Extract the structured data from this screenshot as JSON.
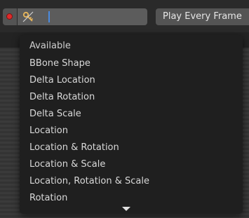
{
  "header": {
    "record_icon": "record-dot-icon",
    "keying_set_icon": "keying-set-key-icon",
    "keying_set_value": "",
    "playback_mode": "Play Every Frame"
  },
  "menu": {
    "title": "Available",
    "items": [
      {
        "label": "BBone Shape"
      },
      {
        "label": "Delta Location"
      },
      {
        "label": "Delta Rotation"
      },
      {
        "label": "Delta Scale"
      },
      {
        "label": "Location"
      },
      {
        "label": "Location & Rotation"
      },
      {
        "label": "Location & Scale"
      },
      {
        "label": "Location, Rotation & Scale"
      },
      {
        "label": "Rotation"
      }
    ],
    "scroll_indicator_icon": "chevron-down-icon"
  },
  "colors": {
    "record": "#e02a2a",
    "cursor": "#4a8be0",
    "menu_bg": "#1f1f1f"
  }
}
